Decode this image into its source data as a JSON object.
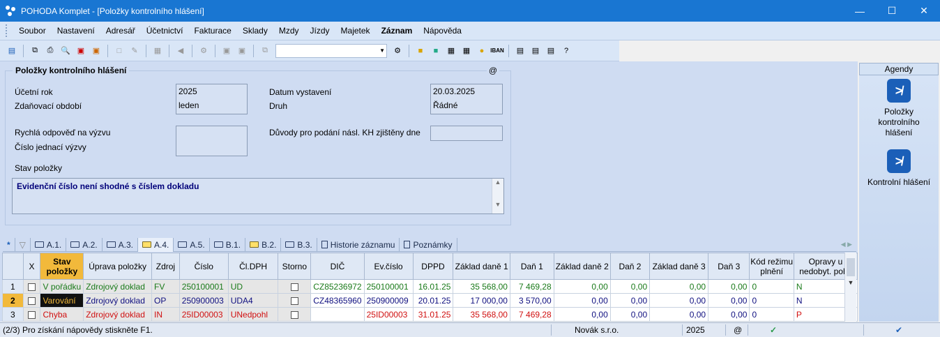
{
  "window": {
    "title": "POHODA Komplet - [Položky kontrolního hlášení]"
  },
  "menu": [
    "Soubor",
    "Nastavení",
    "Adresář",
    "Účetnictví",
    "Fakturace",
    "Sklady",
    "Mzdy",
    "Jízdy",
    "Majetek",
    "Záznam",
    "Nápověda"
  ],
  "form": {
    "group_title": "Položky kontrolního hlášení",
    "at_symbol": "@",
    "ucetni_rok_label": "Účetní rok",
    "ucetni_rok": "2025",
    "zdanovaci_obdobi_label": "Zdaňovací období",
    "zdanovaci_obdobi": "leden",
    "datum_vystaveni_label": "Datum vystavení",
    "datum_vystaveni": "20.03.2025",
    "druh_label": "Druh",
    "druh": "Řádné",
    "rychla_odpoved_label": "Rychlá odpověď na výzvu",
    "cislo_jednaci_label": "Číslo jednací výzvy",
    "duvody_label": "Důvody pro podání násl. KH zjištěny dne",
    "stav_polozky_label": "Stav položky",
    "stav_polozky_text": "Evidenční číslo není shodné s číslem dokladu"
  },
  "tabs": [
    "*",
    "",
    "A.1.",
    "A.2.",
    "A.3.",
    "A.4.",
    "A.5.",
    "B.1.",
    "B.2.",
    "B.3.",
    "Historie záznamu",
    "Poznámky"
  ],
  "table": {
    "headers": [
      "",
      "X",
      "Stav položky",
      "Úprava položky",
      "Zdroj",
      "Číslo",
      "Čl.DPH",
      "Storno",
      "DIČ",
      "Ev.číslo",
      "DPPD",
      "Základ daně 1",
      "Daň 1",
      "Základ daně 2",
      "Daň 2",
      "Základ daně 3",
      "Daň 3",
      "Kód režimu plnění",
      "Opravy u nedobyt. pohl."
    ],
    "rows": [
      {
        "n": "1",
        "stav": "V pořádku",
        "uprava": "Zdrojový doklad",
        "zdroj": "FV",
        "cislo": "250100001",
        "cldph": "UD",
        "dic": "CZ85236972",
        "evcislo": "250100001",
        "dppd": "16.01.25",
        "zd1": "35 568,00",
        "dan1": "7 469,28",
        "zd2": "0,00",
        "dan2": "0,00",
        "zd3": "0,00",
        "dan3": "0,00",
        "kod": "0",
        "opravy": "N"
      },
      {
        "n": "2",
        "stav": "Varování",
        "uprava": "Zdrojový doklad",
        "zdroj": "OP",
        "cislo": "250900003",
        "cldph": "UDA4",
        "dic": "CZ48365960",
        "evcislo": "250900009",
        "dppd": "20.01.25",
        "zd1": "17 000,00",
        "dan1": "3 570,00",
        "zd2": "0,00",
        "dan2": "0,00",
        "zd3": "0,00",
        "dan3": "0,00",
        "kod": "0",
        "opravy": "N"
      },
      {
        "n": "3",
        "stav": "Chyba",
        "uprava": "Zdrojový doklad",
        "zdroj": "IN",
        "cislo": "25ID00003",
        "cldph": "UNedpohl",
        "dic": "",
        "evcislo": "25ID00003",
        "dppd": "31.01.25",
        "zd1": "35 568,00",
        "dan1": "7 469,28",
        "zd2": "0,00",
        "dan2": "0,00",
        "zd3": "0,00",
        "dan3": "0,00",
        "kod": "0",
        "opravy": "P"
      }
    ]
  },
  "agendy": {
    "title": "Agendy",
    "items": [
      "Položky kontrolního hlášení",
      "Kontrolní hlášení"
    ]
  },
  "status": {
    "help": "(2/3) Pro získání nápovědy stiskněte F1.",
    "company": "Novák s.r.o.",
    "year": "2025",
    "at": "@"
  },
  "colors": {
    "accent": "#1976d2",
    "warning": "#f2b93b",
    "ok": "#1a7a1a",
    "error": "#d01010"
  }
}
